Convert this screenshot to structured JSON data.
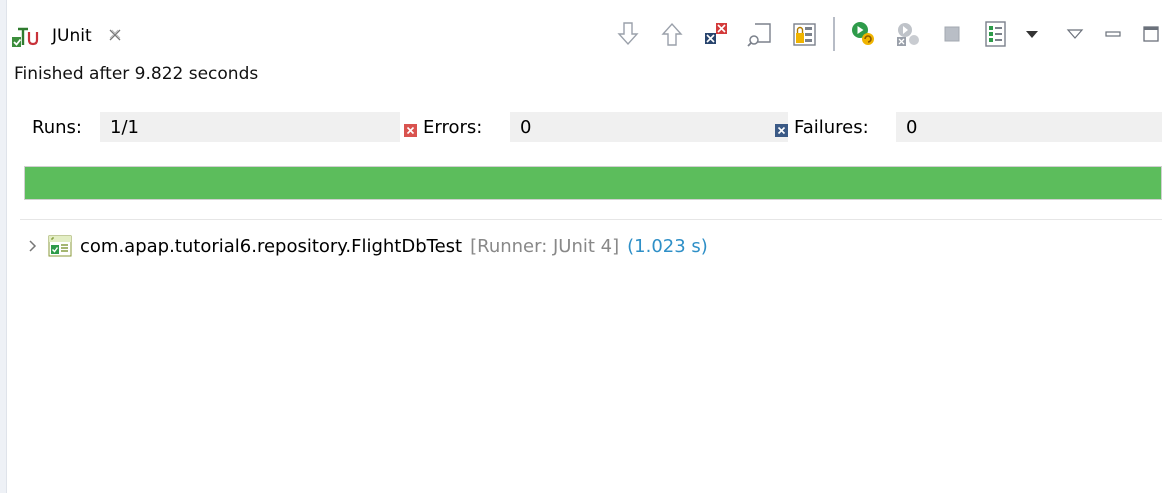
{
  "view": {
    "tab_label": "JUnit",
    "tab_icon": "junit-icon",
    "close_icon": "close-icon"
  },
  "toolbar": {
    "buttons": [
      {
        "icon": "next-failure-icon"
      },
      {
        "icon": "previous-failure-icon"
      },
      {
        "icon": "show-failures-only-icon"
      },
      {
        "icon": "scroll-lock-icon"
      },
      {
        "icon": "show-skipped-icon"
      },
      {
        "icon": "rerun-test-icon"
      },
      {
        "icon": "rerun-failures-first-icon"
      },
      {
        "icon": "stop-icon"
      },
      {
        "icon": "test-run-history-icon"
      },
      {
        "icon": "dropdown-arrow-icon"
      },
      {
        "icon": "view-menu-icon"
      },
      {
        "icon": "minimize-icon"
      },
      {
        "icon": "maximize-icon"
      }
    ]
  },
  "status": "Finished after 9.822 seconds",
  "counters": {
    "runs_label": "Runs:",
    "runs_value": "1/1",
    "errors_label": "Errors:",
    "errors_value": "0",
    "failures_label": "Failures:",
    "failures_value": "0"
  },
  "progress": {
    "fraction": 1.0,
    "color": "#5cbd5c"
  },
  "tree": {
    "items": [
      {
        "name": "com.apap.tutorial6.repository.FlightDbTest",
        "runner": "[Runner: JUnit 4]",
        "duration": "(1.023 s)",
        "icon": "test-class-success-icon",
        "expand_icon": "chevron-right-icon"
      }
    ]
  },
  "colors": {
    "success": "#5cbd5c",
    "error_icon": "#d9534f",
    "failure_icon": "#3b5a86",
    "duration": "#2e8fc7"
  }
}
